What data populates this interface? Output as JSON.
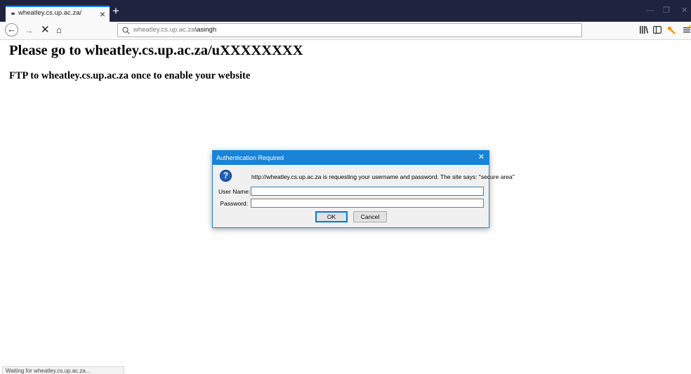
{
  "tab": {
    "title": "wheatley.cs.up.ac.za/",
    "close": "×",
    "new_tab": "+"
  },
  "window_controls": {
    "minimize": "—",
    "restore": "❐",
    "close": "✕"
  },
  "nav": {
    "back": "←",
    "forward": "→",
    "stop": "✕",
    "home": "⌂",
    "url_host": "wheatley.cs.up.ac.za",
    "url_path": "\\asingh",
    "search_icon": "🔍"
  },
  "toolbar_icons": [
    "library-icon",
    "sidebar-icon",
    "extension-icon",
    "menu-icon"
  ],
  "page": {
    "heading": "Please go to wheatley.cs.up.ac.za/uXXXXXXXX",
    "subheading": "FTP to wheatley.cs.up.ac.za once to enable your website"
  },
  "dialog": {
    "title": "Authentication Required",
    "close": "✕",
    "help_glyph": "?",
    "message": "http://wheatley.cs.up.ac.za is requesting your username and password. The site says: \"secure area\"",
    "username_label": "User Name:",
    "password_label": "Password:",
    "username_value": "",
    "password_value": "",
    "ok_label": "OK",
    "cancel_label": "Cancel"
  },
  "status": {
    "text": "Waiting for wheatley.cs.up.ac.za..."
  },
  "colors": {
    "tabstrip": "#202340",
    "accent": "#0a84ff",
    "dialog_title": "#1883d7"
  }
}
